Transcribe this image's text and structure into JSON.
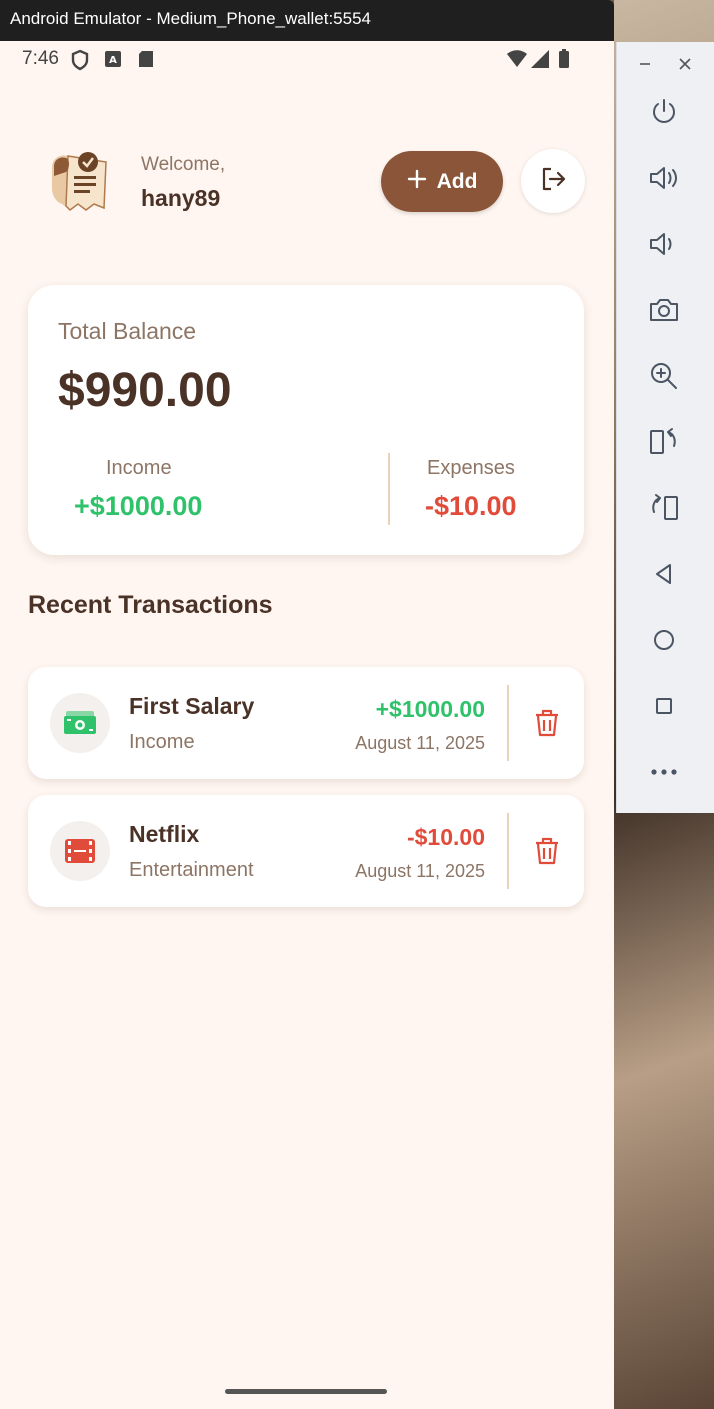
{
  "window": {
    "title": "Android Emulator - Medium_Phone_wallet:5554"
  },
  "status_bar": {
    "time": "7:46"
  },
  "header": {
    "welcome_label": "Welcome,",
    "username": "hany89",
    "add_label": "Add"
  },
  "balance": {
    "label": "Total Balance",
    "amount": "$990.00",
    "income_label": "Income",
    "income_amount": "+$1000.00",
    "expenses_label": "Expenses",
    "expenses_amount": "-$10.00"
  },
  "recent": {
    "title": "Recent Transactions",
    "transactions": [
      {
        "name": "First Salary",
        "category": "Income",
        "amount": "+$1000.00",
        "date": "August 11, 2025",
        "icon": "money-icon",
        "amount_color": "#2fc26a"
      },
      {
        "name": "Netflix",
        "category": "Entertainment",
        "amount": "-$10.00",
        "date": "August 11, 2025",
        "icon": "film-icon",
        "amount_color": "#e04b3a"
      }
    ]
  },
  "colors": {
    "accent": "#8a5538",
    "income": "#2fc26a",
    "expense": "#e04b3a",
    "background": "#fff6f1"
  },
  "emulator_toolbar": {
    "buttons": [
      "minimize-icon",
      "close-icon",
      "power-icon",
      "volume-up-icon",
      "volume-down-icon",
      "camera-icon",
      "zoom-icon",
      "rotate-left-icon",
      "rotate-right-icon",
      "back-icon",
      "home-icon",
      "overview-icon",
      "more-icon"
    ]
  }
}
